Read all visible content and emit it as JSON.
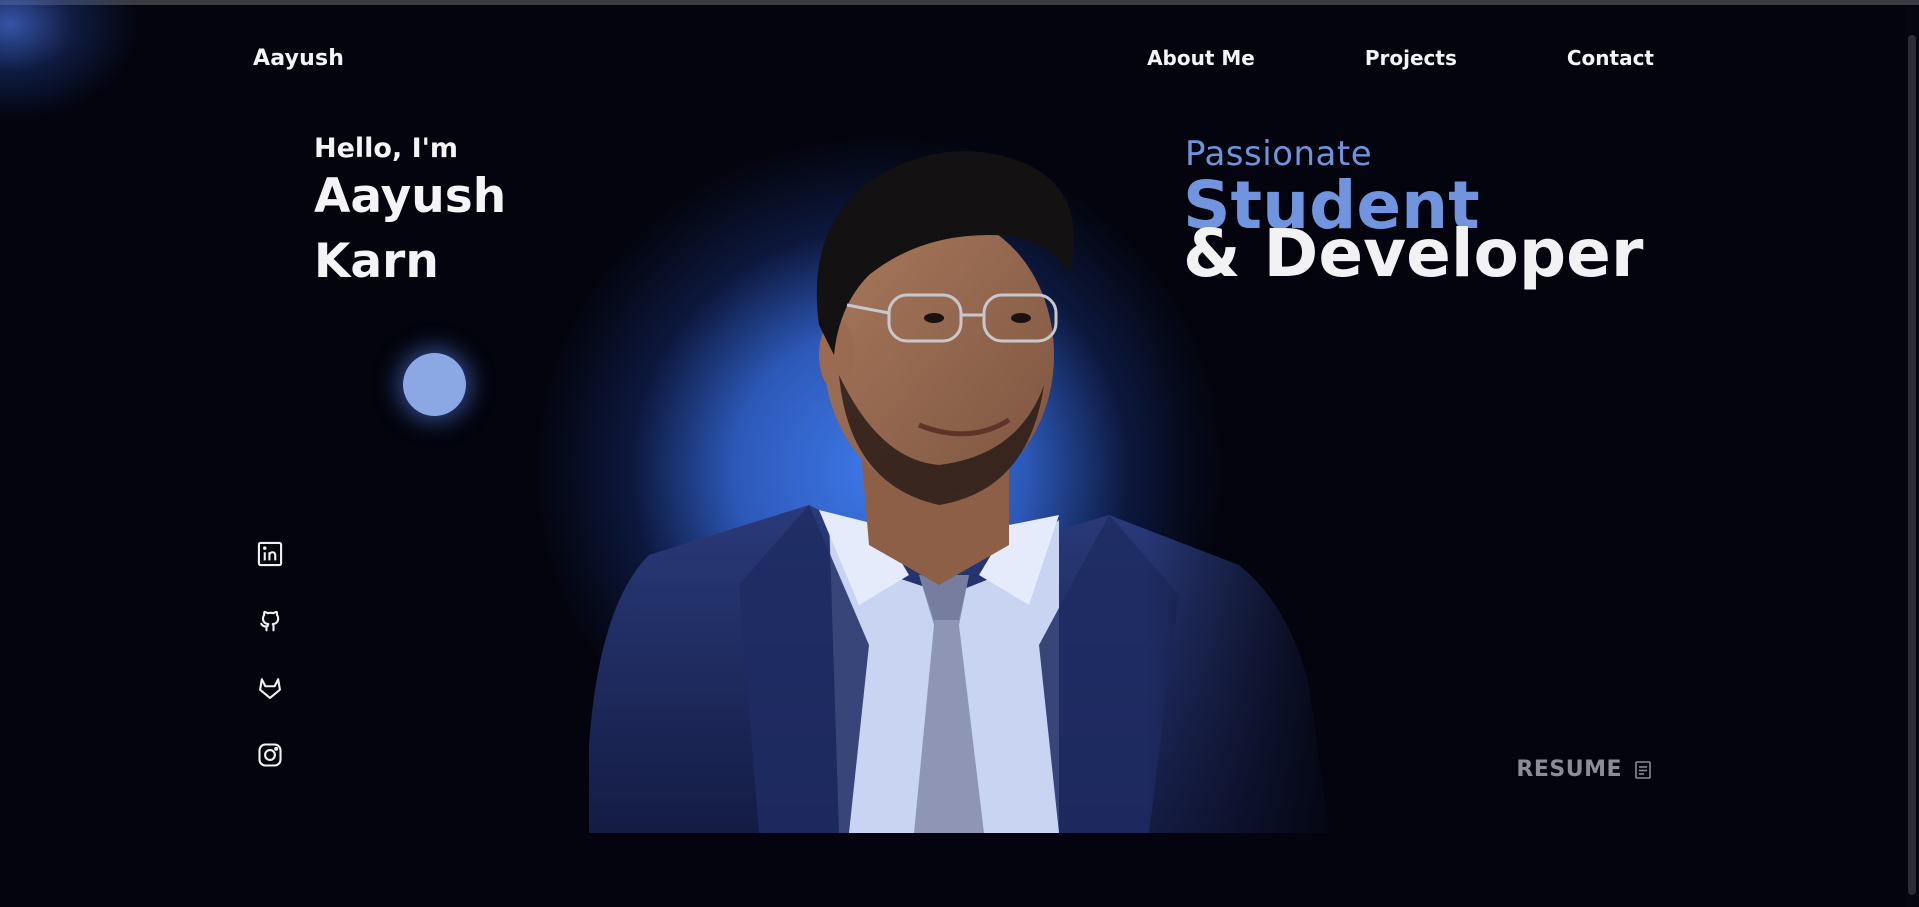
{
  "header": {
    "brand": "Aayush",
    "nav": [
      {
        "label": "About Me"
      },
      {
        "label": "Projects"
      },
      {
        "label": "Contact"
      }
    ]
  },
  "hero": {
    "greeting": "Hello, I'm",
    "name_line1": "Aayush",
    "name_line2": "Karn",
    "tagline_1": "Passionate",
    "tagline_2": "Student",
    "tagline_3": "& Developer"
  },
  "social": [
    {
      "icon": "linkedin-icon"
    },
    {
      "icon": "github-icon"
    },
    {
      "icon": "gitlab-icon"
    },
    {
      "icon": "instagram-icon"
    }
  ],
  "resume": {
    "label": "RESUME",
    "icon": "document-icon"
  },
  "colors": {
    "background": "#03040d",
    "accent_blue": "#7094de",
    "orb": "#8ba8e4",
    "halo": "#3e78e8",
    "text": "#f2f2f5",
    "muted": "#8c8c94"
  }
}
